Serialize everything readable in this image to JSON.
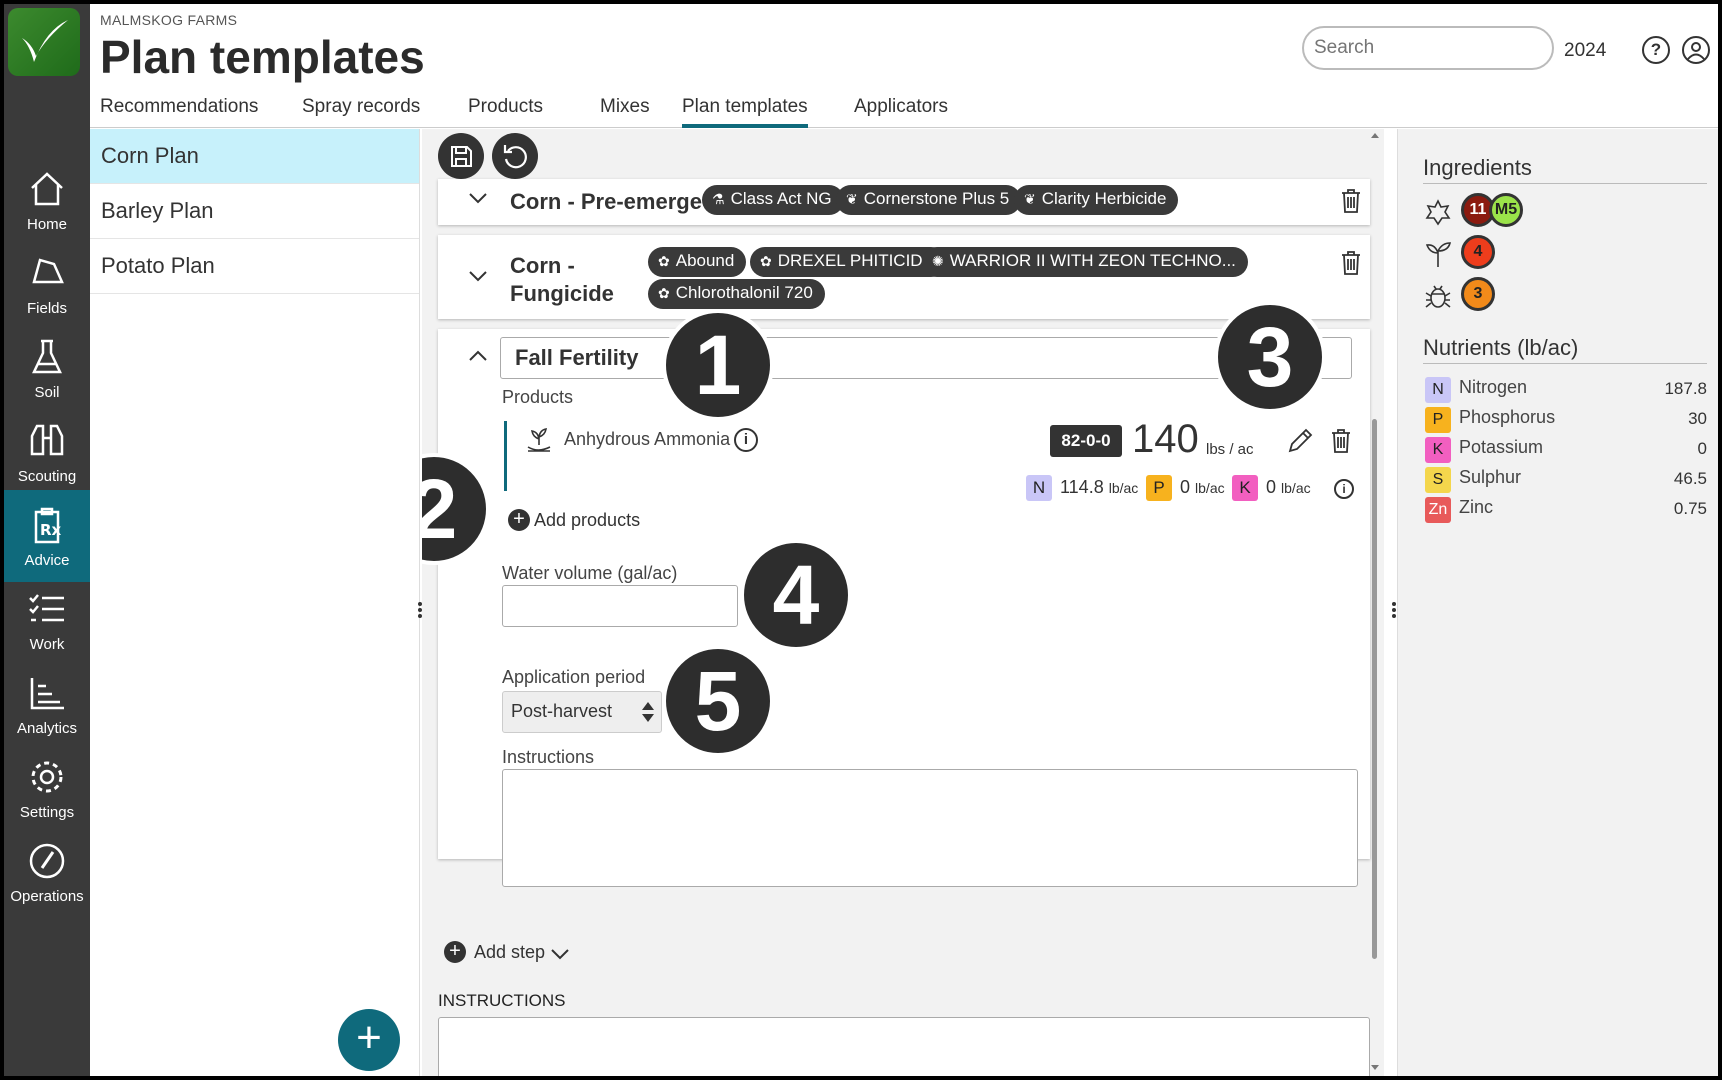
{
  "app": {
    "farm": "MALMSKOG FARMS",
    "title": "Plan templates"
  },
  "header": {
    "search_placeholder": "Search",
    "year": "2024"
  },
  "tabs": [
    "Recommendations",
    "Spray records",
    "Products",
    "Mixes",
    "Plan templates",
    "Applicators"
  ],
  "active_tab": "Plan templates",
  "rail": [
    {
      "label": "Home",
      "icon": "home-icon"
    },
    {
      "label": "Fields",
      "icon": "field-icon"
    },
    {
      "label": "Soil",
      "icon": "flask-icon"
    },
    {
      "label": "Scouting",
      "icon": "binoculars-icon"
    },
    {
      "label": "Advice",
      "icon": "prescription-icon",
      "active": true
    },
    {
      "label": "Work",
      "icon": "checklist-icon"
    },
    {
      "label": "Analytics",
      "icon": "chart-icon"
    },
    {
      "label": "Settings",
      "icon": "gear-icon"
    },
    {
      "label": "Operations",
      "icon": "gauge-icon"
    }
  ],
  "plans": [
    "Corn Plan",
    "Barley Plan",
    "Potato Plan"
  ],
  "steps": {
    "pre_emerge": {
      "title": "Corn - Pre-emerge",
      "chips": [
        "Class Act NG",
        "Cornerstone Plus 5",
        "Clarity Herbicide"
      ]
    },
    "fungicide": {
      "title_line1": "Corn -",
      "title_line2": "Fungicide",
      "chips": [
        "Abound",
        "DREXEL PHITICIDE",
        "WARRIOR II WITH ZEON TECHNO...",
        "Chlorothalonil 720"
      ]
    },
    "fall": {
      "title": "Fall Fertility",
      "products_label": "Products",
      "product_name": "Anhydrous Ammonia",
      "analysis": "82-0-0",
      "rate": "140",
      "rate_unit": "lbs / ac",
      "nutrients": [
        {
          "letter": "N",
          "value": "114.8",
          "unit": "lb/ac",
          "color": "#c9c6f7"
        },
        {
          "letter": "P",
          "value": "0",
          "unit": "lb/ac",
          "color": "#f7b21e"
        },
        {
          "letter": "K",
          "value": "0",
          "unit": "lb/ac",
          "color": "#f25fc0"
        }
      ],
      "add_products": "Add products",
      "water_label": "Water volume (gal/ac)",
      "water_value": "",
      "period_label": "Application period",
      "period_value": "Post-harvest",
      "instructions_label": "Instructions"
    }
  },
  "add_step": "Add step",
  "instructions_heading": "INSTRUCTIONS",
  "callouts": [
    "1",
    "2",
    "3",
    "4",
    "5"
  ],
  "right": {
    "ingredients_heading": "Ingredients",
    "ingredients": [
      {
        "icon": "fungus-icon",
        "badges": [
          {
            "text": "11",
            "color": "#8b1a0f"
          },
          {
            "text": "M5",
            "color": "#9be34a"
          }
        ]
      },
      {
        "icon": "sprout-icon",
        "badges": [
          {
            "text": "4",
            "color": "#ee3d1c"
          }
        ]
      },
      {
        "icon": "bug-icon",
        "badges": [
          {
            "text": "3",
            "color": "#f28a1a"
          }
        ]
      }
    ],
    "nutrients_heading": "Nutrients (lb/ac)",
    "nutrients": [
      {
        "sym": "N",
        "name": "Nitrogen",
        "value": "187.8",
        "color": "#c9c6f7"
      },
      {
        "sym": "P",
        "name": "Phosphorus",
        "value": "30",
        "color": "#f7b21e"
      },
      {
        "sym": "K",
        "name": "Potassium",
        "value": "0",
        "color": "#f25fc0"
      },
      {
        "sym": "S",
        "name": "Sulphur",
        "value": "46.5",
        "color": "#f4d64c"
      },
      {
        "sym": "Zn",
        "name": "Zinc",
        "value": "0.75",
        "color": "#e85a5a"
      }
    ]
  }
}
